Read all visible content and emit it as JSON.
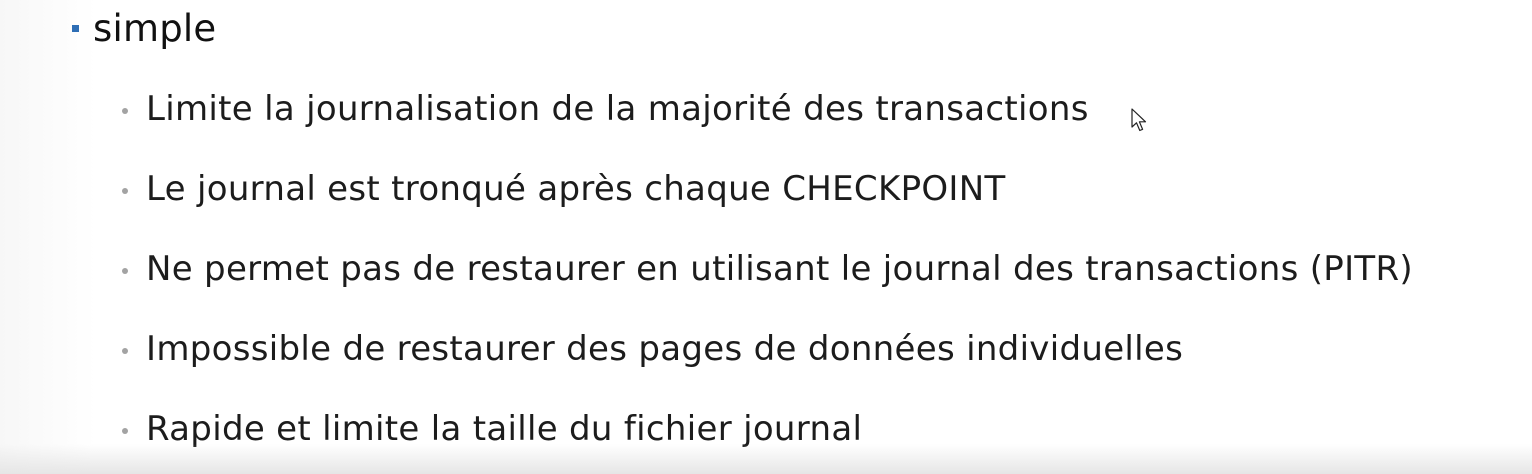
{
  "heading": {
    "text": "simple"
  },
  "bullets": [
    {
      "text": "Limite la journalisation de la majorité des transactions"
    },
    {
      "text": "Le journal est tronqué après chaque CHECKPOINT"
    },
    {
      "text": "Ne permet pas de restaurer en utilisant le journal des transactions (PITR)"
    },
    {
      "text": "Impossible de restaurer des pages de données individuelles"
    },
    {
      "text": "Rapide et limite la taille du fichier journal"
    }
  ],
  "colors": {
    "accent_bullet": "#2e6eb5",
    "sub_bullet": "#a3a3a3",
    "text": "#1c1c1c"
  },
  "icons": {
    "cursor": "mouse-pointer-icon"
  }
}
